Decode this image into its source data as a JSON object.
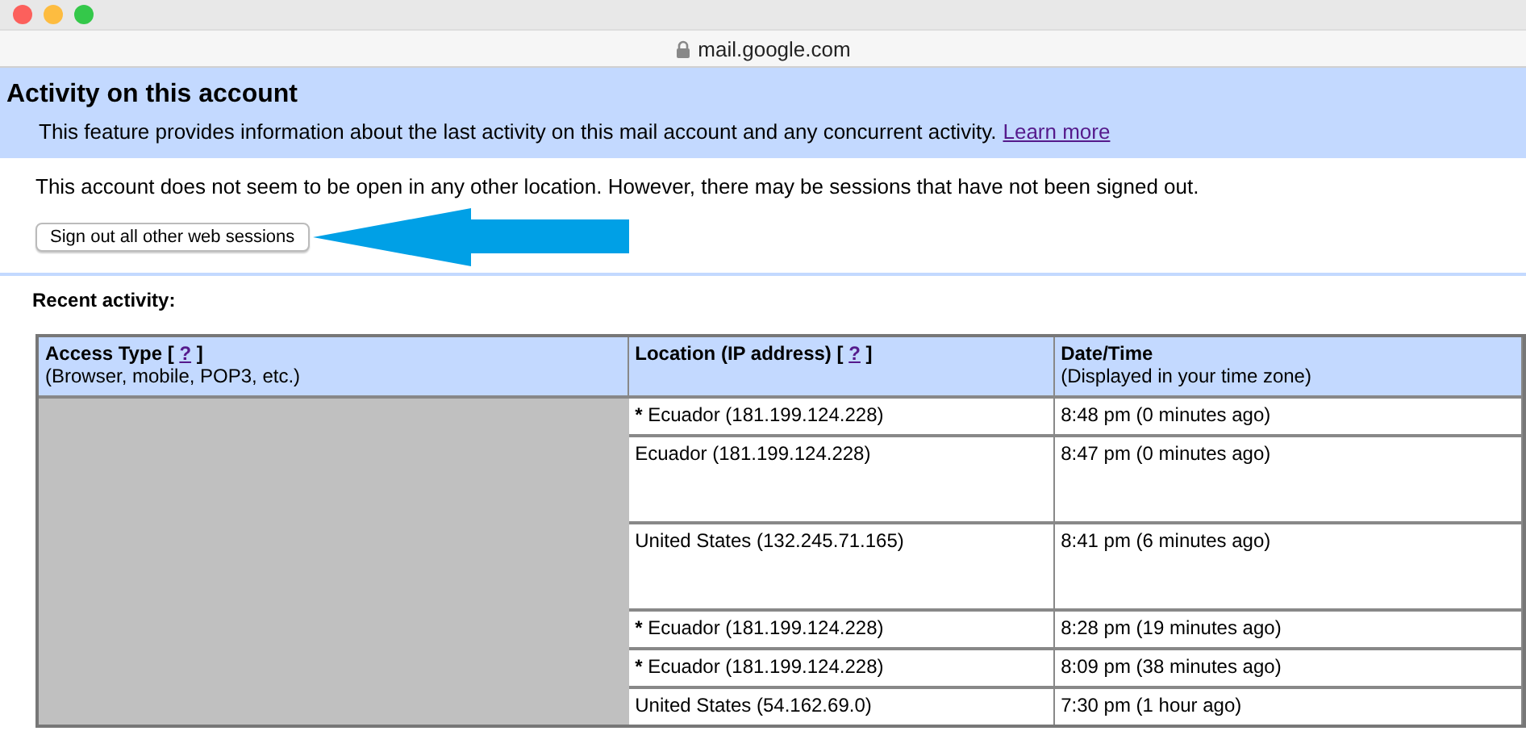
{
  "window": {
    "url": "mail.google.com"
  },
  "header": {
    "title": "Activity on this account",
    "description": "This feature provides information about the last activity on this mail account and any concurrent activity.",
    "link": "Learn more"
  },
  "notice": "This account does not seem to be open in any other location. However, there may be sessions that have not been signed out.",
  "sign_out_button": "Sign out all other web sessions",
  "section_title": "Recent activity:",
  "table": {
    "columns": [
      {
        "title": "Access Type",
        "bracket_open": "[",
        "help": "?",
        "bracket_close": "]",
        "subtitle": "(Browser, mobile, POP3, etc.)"
      },
      {
        "title": "Location (IP address)",
        "bracket_open": "[",
        "help": "?",
        "bracket_close": "]"
      },
      {
        "title": "Date/Time",
        "subtitle": "(Displayed in your time zone)"
      }
    ],
    "rows": [
      {
        "kind": "short",
        "marker": "*",
        "location": "Ecuador (181.199.124.228)",
        "time": "8:48 pm (0 minutes ago)"
      },
      {
        "kind": "tall",
        "location": "Ecuador (181.199.124.228)",
        "time": "8:47 pm (0 minutes ago)"
      },
      {
        "kind": "tall",
        "location": "United States (132.245.71.165)",
        "time": "8:41 pm (6 minutes ago)"
      },
      {
        "kind": "short",
        "marker": "*",
        "location": "Ecuador (181.199.124.228)",
        "time": "8:28 pm (19 minutes ago)"
      },
      {
        "kind": "short",
        "marker": "*",
        "location": "Ecuador (181.199.124.228)",
        "time": "8:09 pm (38 minutes ago)"
      },
      {
        "kind": "short",
        "location": "United States (54.162.69.0)",
        "time": "7:30 pm (1 hour ago)"
      }
    ]
  }
}
